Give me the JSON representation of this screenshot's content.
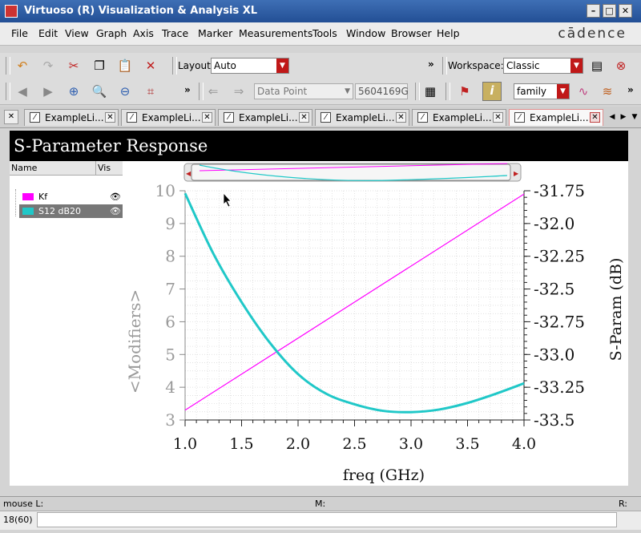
{
  "window": {
    "title": "Virtuoso (R) Visualization & Analysis XL"
  },
  "menubar": {
    "items": [
      "File",
      "Edit",
      "View",
      "Graph",
      "Axis",
      "Trace",
      "Marker",
      "Measurements",
      "Tools",
      "Window",
      "Browser",
      "Help"
    ],
    "brand": "cādence"
  },
  "toolbar1": {
    "layout_label": "Layout:",
    "layout_value": "Auto",
    "workspace_label": "Workspace:",
    "workspace_value": "Classic"
  },
  "toolbar2": {
    "data_point_value": "Data Point",
    "count_value": "5604169G",
    "family_value": "family"
  },
  "tabs": [
    {
      "label": "ExampleLi..."
    },
    {
      "label": "ExampleLi..."
    },
    {
      "label": "ExampleLi..."
    },
    {
      "label": "ExampleLi..."
    },
    {
      "label": "ExampleLi..."
    },
    {
      "label": "ExampleLi..."
    }
  ],
  "graph": {
    "title": "S-Parameter Response"
  },
  "legend": {
    "col_name": "Name",
    "col_vis": "Vis",
    "traces": [
      {
        "name": "Kf",
        "color": "#ff00ff"
      },
      {
        "name": "S12 dB20",
        "color": "#20c8c8"
      }
    ]
  },
  "chart_data": {
    "type": "line",
    "xlabel": "freq (GHz)",
    "ylabel_left": "<Modifiers>",
    "ylabel_right": "S-Param (dB)",
    "xlim": [
      1.0,
      4.0
    ],
    "ylim_left": [
      3,
      10
    ],
    "ylim_right": [
      -33.5,
      -31.75
    ],
    "x_ticks": [
      "1.0",
      "1.5",
      "2.0",
      "2.5",
      "3.0",
      "3.5",
      "4.0"
    ],
    "y_left_ticks": [
      "3",
      "4",
      "5",
      "6",
      "7",
      "8",
      "9",
      "10"
    ],
    "y_right_ticks": [
      "-31.75",
      "-32.0",
      "-32.25",
      "-32.5",
      "-32.75",
      "-33.0",
      "-33.25",
      "-33.5"
    ],
    "grid": true,
    "series": [
      {
        "name": "Kf",
        "axis": "left",
        "color": "#ff00ff",
        "x": [
          1.0,
          4.0
        ],
        "y": [
          3.3,
          9.9
        ]
      },
      {
        "name": "S12 dB20",
        "axis": "right",
        "color": "#20c8c8",
        "x": [
          1.0,
          1.25,
          1.5,
          1.75,
          2.0,
          2.25,
          2.5,
          2.75,
          3.0,
          3.25,
          3.5,
          3.75,
          4.0
        ],
        "y": [
          -31.77,
          -32.23,
          -32.6,
          -32.91,
          -33.15,
          -33.3,
          -33.38,
          -33.43,
          -33.44,
          -33.42,
          -33.37,
          -33.3,
          -33.22
        ]
      }
    ]
  },
  "status": {
    "mouse_left": "mouse L:",
    "mouse_mid": "M:",
    "mouse_right": "R:",
    "counter": "18(60)"
  }
}
